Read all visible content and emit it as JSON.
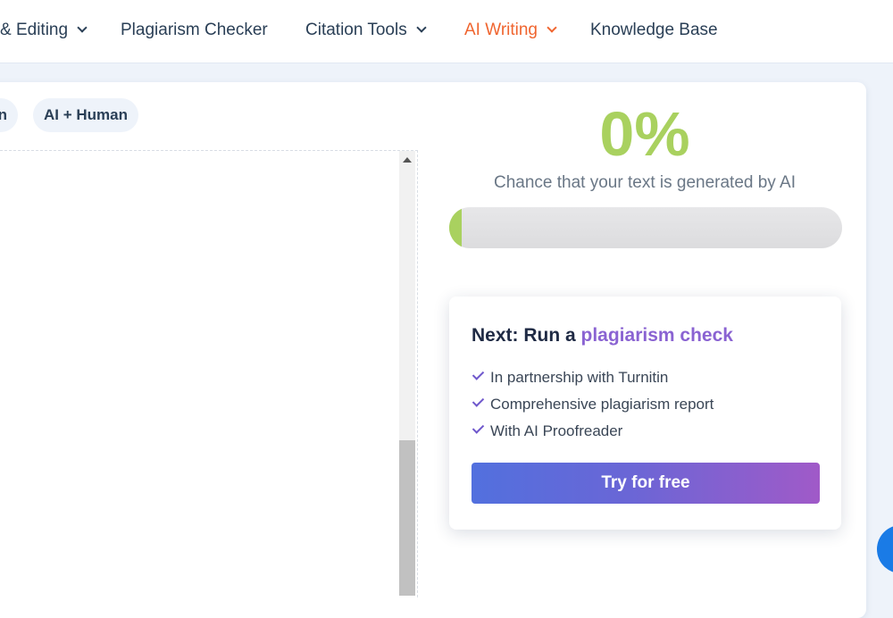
{
  "nav": {
    "items": [
      {
        "label": "& Editing",
        "has_dropdown": true
      },
      {
        "label": "Plagiarism Checker",
        "has_dropdown": false
      },
      {
        "label": "Citation Tools",
        "has_dropdown": true
      },
      {
        "label": "AI Writing",
        "has_dropdown": true,
        "active": true
      },
      {
        "label": "Knowledge Base",
        "has_dropdown": false
      }
    ]
  },
  "mode_chips": [
    {
      "label": "n"
    },
    {
      "label": "AI + Human"
    }
  ],
  "result": {
    "percent": "0%",
    "caption": "Chance that your text is generated by AI",
    "progress_fraction": 0
  },
  "promo": {
    "title_prefix": "Next: Run a ",
    "title_highlight": "plagiarism check",
    "features": [
      "In partnership with Turnitin",
      "Comprehensive plagiarism report",
      "With AI Proofreader"
    ],
    "cta_label": "Try for free"
  },
  "colors": {
    "accent_orange": "#f0652f",
    "result_green": "#a9d15f",
    "highlight_purple": "#8a63d2",
    "cta_gradient_start": "#5270de",
    "cta_gradient_end": "#a05ac8",
    "chat_button_blue": "#1a7be6"
  },
  "icons": {
    "dropdown": "chevron-down-icon",
    "feature_bullet": "checkmark-icon",
    "scroll_up": "triangle-up-icon",
    "chat": "chat-bubble-icon"
  }
}
